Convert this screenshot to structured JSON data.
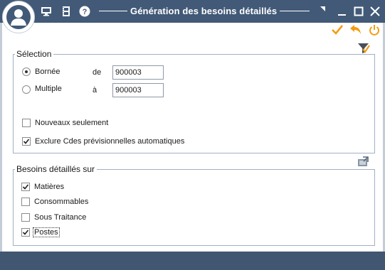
{
  "window": {
    "title": "Génération des besoins détaillés"
  },
  "selection": {
    "legend": "Sélection",
    "radio_bornee": "Bornée",
    "radio_multiple": "Multiple",
    "de_label": "de",
    "a_label": "à",
    "de_value": "900003",
    "a_value": "900003",
    "nouveaux_seulement": "Nouveaux seulement",
    "exclure": "Exclure Cdes prévisionnelles automatiques",
    "mode_selected": "Bornée",
    "nouveaux_checked": false,
    "exclure_checked": true
  },
  "besoins": {
    "legend": "Besoins détaillés sur",
    "items": [
      {
        "label": "Matières",
        "checked": true
      },
      {
        "label": "Consommables",
        "checked": false
      },
      {
        "label": "Sous Traitance",
        "checked": false
      },
      {
        "label": "Postes",
        "checked": true
      }
    ]
  },
  "colors": {
    "titlebar": "#425a77",
    "accent": "#f39c12",
    "border": "#9fb0c6"
  },
  "icons": [
    "user-avatar-icon",
    "monitor-icon",
    "film-icon",
    "help-icon",
    "pin-icon",
    "minimize-icon",
    "maximize-icon",
    "close-icon",
    "validate-check-icon",
    "undo-icon",
    "power-icon",
    "filter-icon",
    "export-icon"
  ]
}
